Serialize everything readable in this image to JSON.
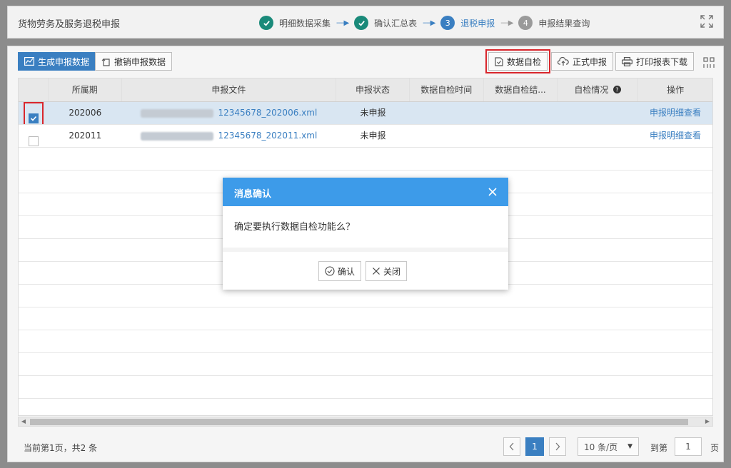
{
  "header": {
    "title": "货物劳务及服务退税申报",
    "steps": [
      {
        "num": "✓",
        "label": "明细数据采集",
        "state": "done"
      },
      {
        "num": "✓",
        "label": "确认汇总表",
        "state": "done"
      },
      {
        "num": "3",
        "label": "退税申报",
        "state": "current"
      },
      {
        "num": "4",
        "label": "申报结果查询",
        "state": "todo"
      }
    ]
  },
  "toolbar": {
    "generate_label": "生成申报数据",
    "revoke_label": "撤销申报数据",
    "selfcheck_label": "数据自检",
    "submit_label": "正式申报",
    "print_label": "打印报表下载"
  },
  "table": {
    "columns": [
      "所属期",
      "申报文件",
      "申报状态",
      "数据自检时间",
      "数据自检结...",
      "自检情况",
      "操作"
    ],
    "rows": [
      {
        "period": "202006",
        "file": "12345678_202006.xml",
        "status": "未申报",
        "check_time": "",
        "check_result": "",
        "check_state": "",
        "action": "申报明细查看",
        "selected": true
      },
      {
        "period": "202011",
        "file": "12345678_202011.xml",
        "status": "未申报",
        "check_time": "",
        "check_result": "",
        "check_state": "",
        "action": "申报明细查看",
        "selected": false
      }
    ]
  },
  "footer": {
    "info": "当前第1页，共2 条",
    "current_page": "1",
    "page_size": "10 条/页",
    "goto_label": "到第",
    "goto_value": "1",
    "page_unit": "页"
  },
  "dialog": {
    "title": "消息确认",
    "message": "确定要执行数据自检功能么？",
    "confirm_label": "确认",
    "close_label": "关闭"
  },
  "colors": {
    "primary": "#3a7fc1",
    "dialog_header": "#3d9be9",
    "done_step": "#1a8a7a",
    "highlight": "#d9262c"
  }
}
